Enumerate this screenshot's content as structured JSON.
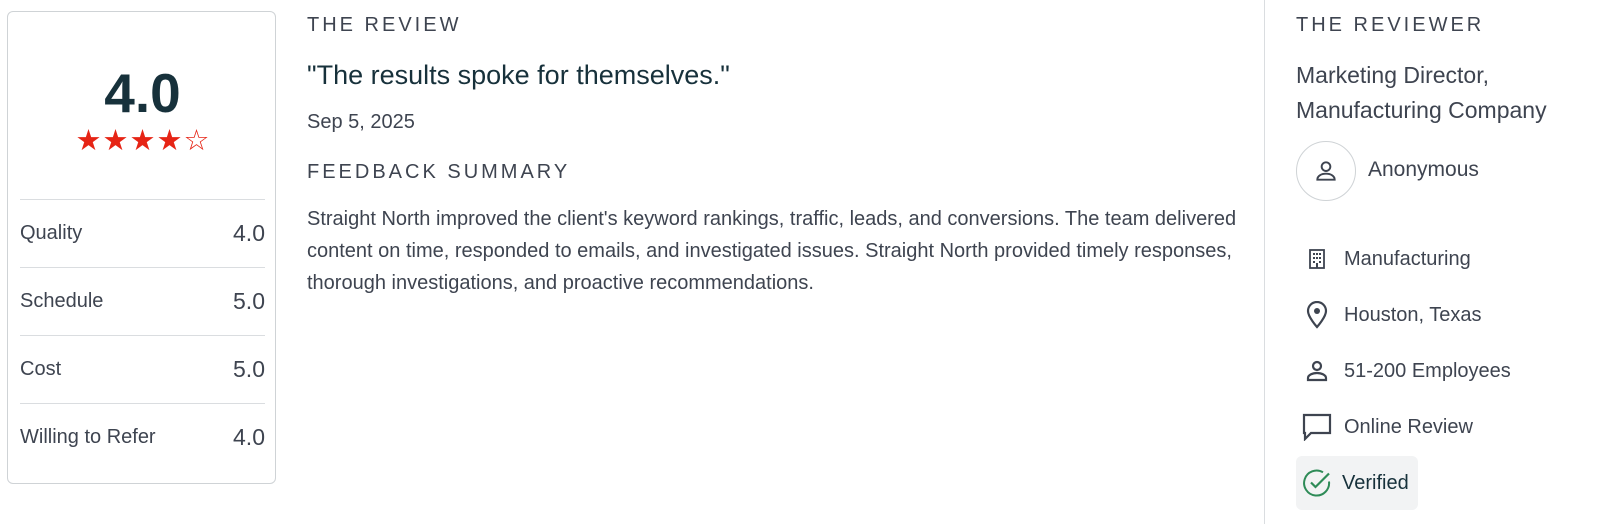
{
  "rating": {
    "overall": "4.0",
    "stars_value": 4,
    "stars_max": 5,
    "rows": [
      {
        "label": "Quality",
        "value": "4.0"
      },
      {
        "label": "Schedule",
        "value": "5.0"
      },
      {
        "label": "Cost",
        "value": "5.0"
      },
      {
        "label": "Willing to Refer",
        "value": "4.0"
      }
    ]
  },
  "review": {
    "heading": "THE REVIEW",
    "title": "\"The results spoke for themselves.\"",
    "date": "Sep 5, 2025",
    "summary_heading": "FEEDBACK SUMMARY",
    "summary": "Straight North improved the client's keyword rankings, traffic, leads, and conversions. The team delivered content on time, responded to emails, and investigated issues. Straight North provided timely responses, thorough investigations, and proactive recommendations."
  },
  "reviewer": {
    "heading": "THE REVIEWER",
    "role_line1": "Marketing Director,",
    "role_line2": "Manufacturing Company",
    "name": "Anonymous",
    "industry": "Manufacturing",
    "location": "Houston, Texas",
    "company_size": "51-200 Employees",
    "review_type": "Online Review",
    "verified": "Verified"
  },
  "colors": {
    "star": "#e62415",
    "heading_dark": "#17313b",
    "verified_green": "#2e8b57"
  },
  "icons": [
    "user-icon",
    "building-icon",
    "location-pin-icon",
    "person-icon",
    "chat-bubble-icon",
    "check-circle-icon"
  ]
}
